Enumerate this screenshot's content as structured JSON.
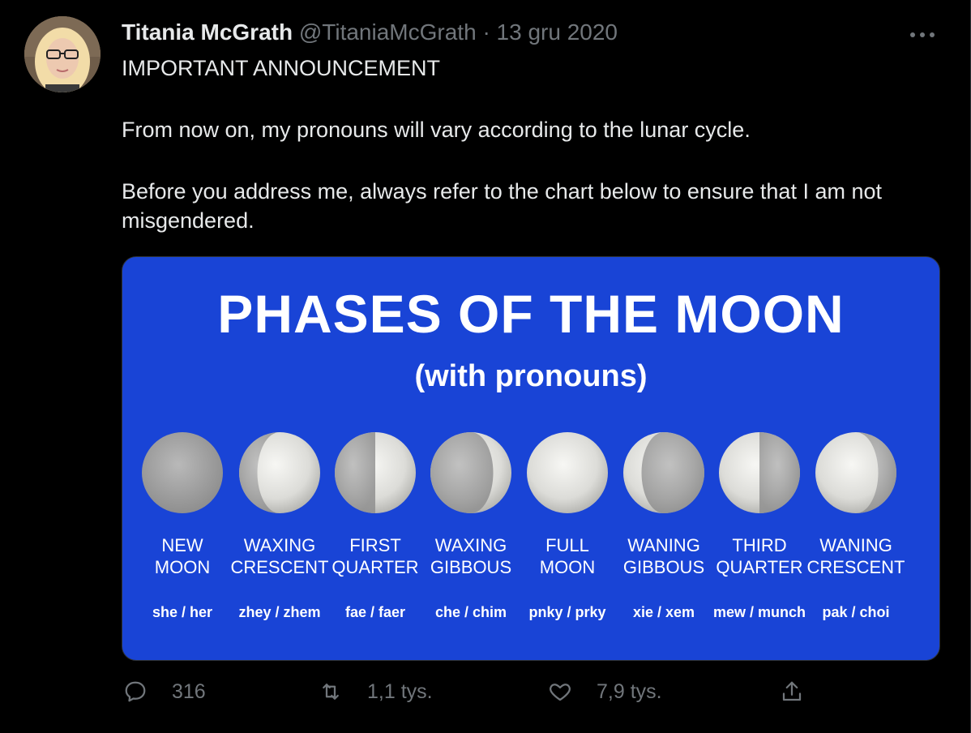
{
  "author": {
    "name": "Titania McGrath",
    "handle": "@TitaniaMcGrath",
    "separator": "·",
    "date": "13 gru 2020"
  },
  "tweet": {
    "line1": "IMPORTANT ANNOUNCEMENT",
    "line2": "From now on, my pronouns will vary according to the lunar cycle.",
    "line3": "Before you address me, always refer to the chart below to ensure that I am not misgendered."
  },
  "media": {
    "title": "PHASES OF THE MOON",
    "subtitle": "(with pronouns)",
    "phases": [
      {
        "line1": "NEW",
        "line2": "MOON",
        "pronoun": "she / her"
      },
      {
        "line1": "WAXING",
        "line2": "CRESCENT",
        "pronoun": "zhey / zhem"
      },
      {
        "line1": "FIRST",
        "line2": "QUARTER",
        "pronoun": "fae / faer"
      },
      {
        "line1": "WAXING",
        "line2": "GIBBOUS",
        "pronoun": "che / chim"
      },
      {
        "line1": "FULL",
        "line2": "MOON",
        "pronoun": "pnky / prky"
      },
      {
        "line1": "WANING",
        "line2": "GIBBOUS",
        "pronoun": "xie / xem"
      },
      {
        "line1": "THIRD",
        "line2": "QUARTER",
        "pronoun": "mew / munch"
      },
      {
        "line1": "WANING",
        "line2": "CRESCENT",
        "pronoun": "pak / choi"
      }
    ]
  },
  "actions": {
    "replies": "316",
    "retweets": "1,1 tys.",
    "likes": "7,9 tys."
  },
  "icons": {
    "more": "more-icon",
    "reply": "reply-icon",
    "retweet": "retweet-icon",
    "like": "heart-icon",
    "share": "share-icon"
  },
  "colors": {
    "background": "#000000",
    "secondary_text": "#71767b",
    "media_blue": "#1944d6"
  }
}
